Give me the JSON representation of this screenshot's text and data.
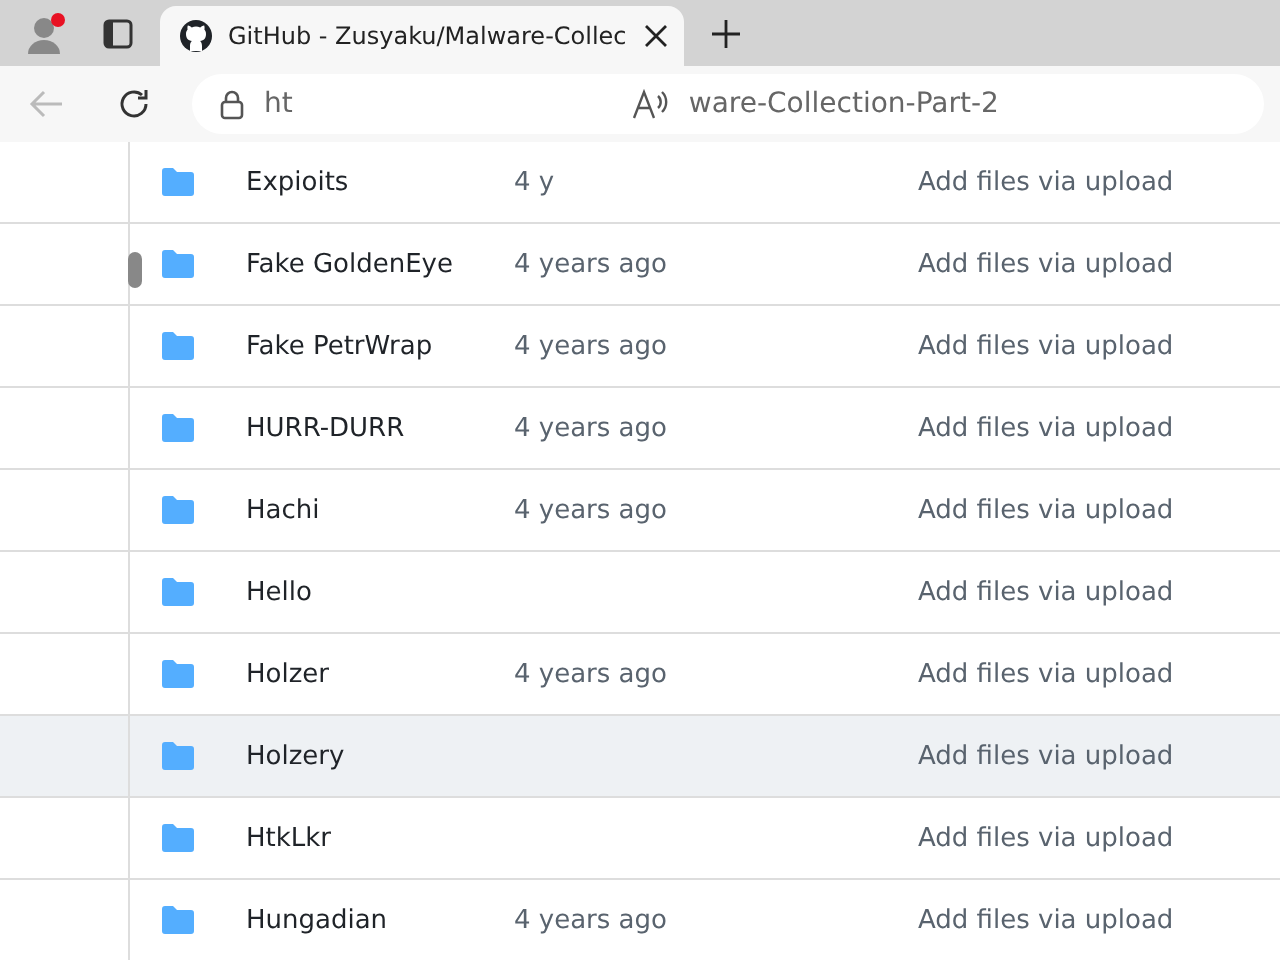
{
  "browser": {
    "tab_title": "GitHub - Zusyaku/Malware-Collec",
    "address_start": "ht",
    "address_end": "ware-Collection-Part-2"
  },
  "files": [
    {
      "name": "Expioits",
      "time": "4 y",
      "message": "Add files via upload",
      "selected": false
    },
    {
      "name": "Fake GoldenEye",
      "time": "4 years ago",
      "message": "Add files via upload",
      "selected": false
    },
    {
      "name": "Fake PetrWrap",
      "time": "4 years ago",
      "message": "Add files via upload",
      "selected": false
    },
    {
      "name": "HURR-DURR",
      "time": "4 years ago",
      "message": "Add files via upload",
      "selected": false
    },
    {
      "name": "Hachi",
      "time": "4 years ago",
      "message": "Add files via upload",
      "selected": false
    },
    {
      "name": "Hello",
      "message": "Add files via upload",
      "selected": false
    },
    {
      "name": "Holzer",
      "time": "4 years ago",
      "message": "Add files via upload",
      "selected": false
    },
    {
      "name": "Holzery",
      "message": "Add files via upload",
      "selected": true
    },
    {
      "name": "HtkLkr",
      "message": "Add files via upload",
      "selected": false
    },
    {
      "name": "Hungadian",
      "time": "4 years ago",
      "message": "Add files via upload",
      "selected": false
    }
  ]
}
